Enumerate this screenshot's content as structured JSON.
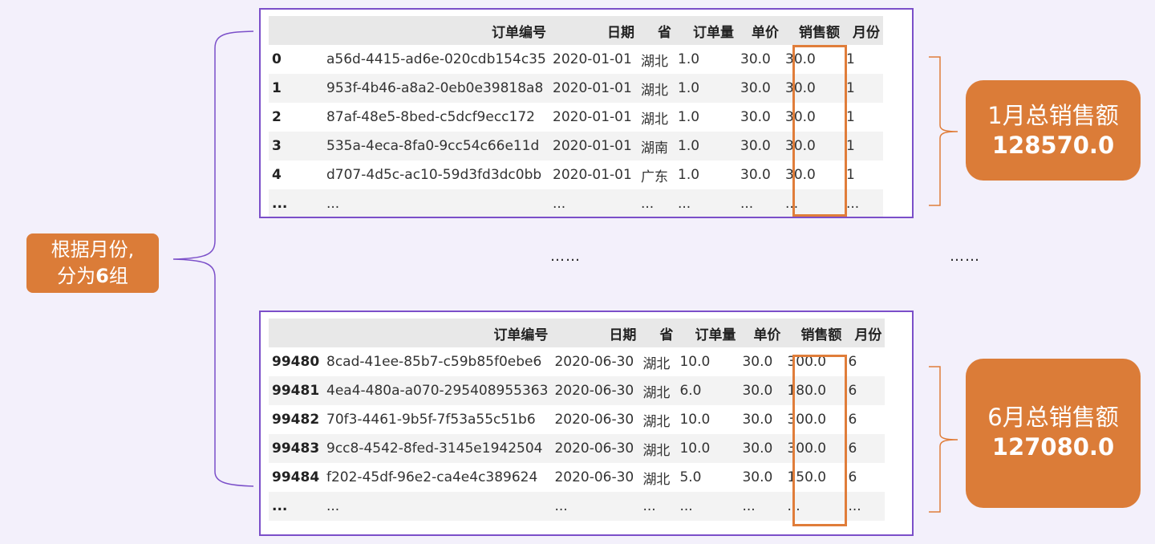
{
  "group_label": {
    "line1": "根据月份,",
    "line2_prefix": "分为",
    "line2_bold": "6",
    "line2_suffix": "组"
  },
  "columns": [
    "",
    "订单编号",
    "日期",
    "省",
    "订单量",
    "单价",
    "销售额",
    "月份"
  ],
  "table_top": {
    "rows": [
      [
        "0",
        "a56d-4415-ad6e-020cdb154c35",
        "2020-01-01",
        "湖北",
        "1.0",
        "30.0",
        "30.0",
        "1"
      ],
      [
        "1",
        "953f-4b46-a8a2-0eb0e39818a8",
        "2020-01-01",
        "湖北",
        "1.0",
        "30.0",
        "30.0",
        "1"
      ],
      [
        "2",
        "87af-48e5-8bed-c5dcf9ecc172",
        "2020-01-01",
        "湖北",
        "1.0",
        "30.0",
        "30.0",
        "1"
      ],
      [
        "3",
        "535a-4eca-8fa0-9cc54c66e11d",
        "2020-01-01",
        "湖南",
        "1.0",
        "30.0",
        "30.0",
        "1"
      ],
      [
        "4",
        "d707-4d5c-ac10-59d3fd3dc0bb",
        "2020-01-01",
        "广东",
        "1.0",
        "30.0",
        "30.0",
        "1"
      ],
      [
        "...",
        "...",
        "...",
        "...",
        "...",
        "...",
        "...",
        "..."
      ]
    ]
  },
  "table_bottom": {
    "rows": [
      [
        "99480",
        "8cad-41ee-85b7-c59b85f0ebe6",
        "2020-06-30",
        "湖北",
        "10.0",
        "30.0",
        "300.0",
        "6"
      ],
      [
        "99481",
        "4ea4-480a-a070-295408955363",
        "2020-06-30",
        "湖北",
        "6.0",
        "30.0",
        "180.0",
        "6"
      ],
      [
        "99482",
        "70f3-4461-9b5f-7f53a55c51b6",
        "2020-06-30",
        "湖北",
        "10.0",
        "30.0",
        "300.0",
        "6"
      ],
      [
        "99483",
        "9cc8-4542-8fed-3145e1942504",
        "2020-06-30",
        "湖北",
        "10.0",
        "30.0",
        "300.0",
        "6"
      ],
      [
        "99484",
        "f202-45df-96e2-ca4e4c389624",
        "2020-06-30",
        "湖北",
        "5.0",
        "30.0",
        "150.0",
        "6"
      ],
      [
        "...",
        "...",
        "...",
        "...",
        "...",
        "...",
        "...",
        "..."
      ]
    ]
  },
  "ellipsis_middle": "……",
  "ellipsis_right": "……",
  "summary_month1": {
    "label": "1月总销售额",
    "value": "128570.0"
  },
  "summary_month6": {
    "label": "6月总销售额",
    "value": "127080.0"
  },
  "colors": {
    "accent_orange": "#db7c38",
    "frame_purple": "#7b4fc9",
    "highlight_orange": "#e07d3a"
  }
}
